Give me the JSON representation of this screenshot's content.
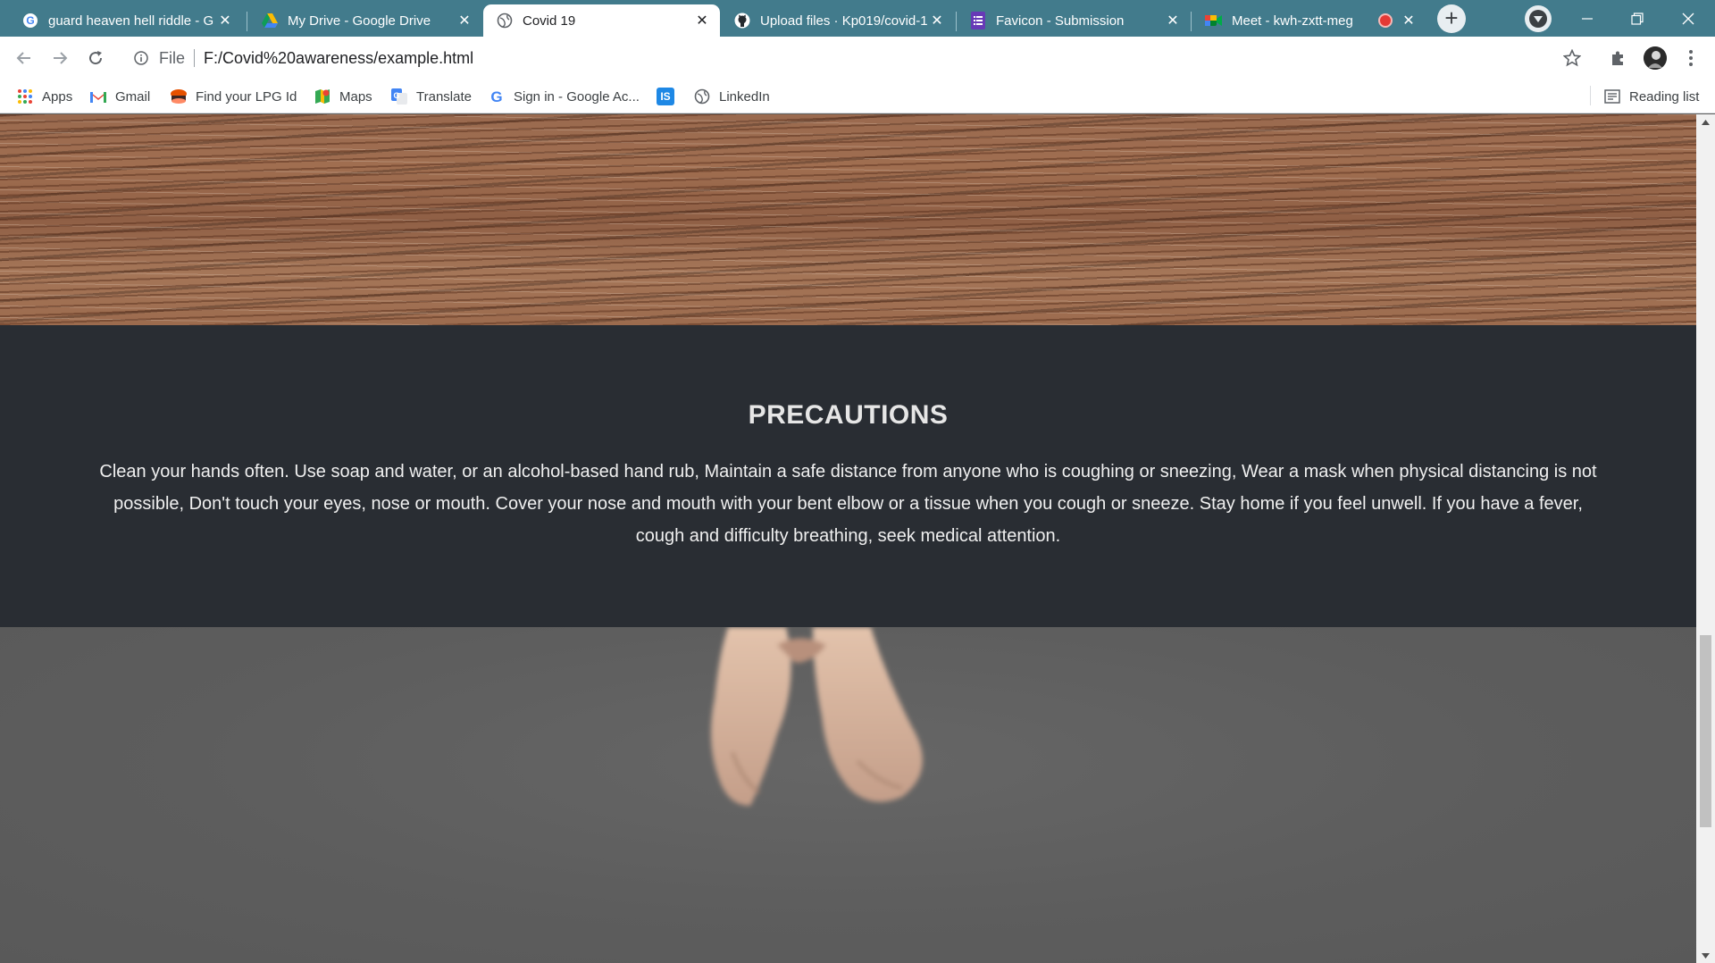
{
  "tabs": [
    {
      "title": "guard heaven hell riddle - G",
      "favicon": "google-icon"
    },
    {
      "title": "My Drive - Google Drive",
      "favicon": "google-drive-icon"
    },
    {
      "title": "Covid 19",
      "favicon": "globe-icon",
      "active": true
    },
    {
      "title": "Upload files · Kp019/covid-1",
      "favicon": "github-icon"
    },
    {
      "title": "Favicon - Submission",
      "favicon": "forms-icon"
    },
    {
      "title": "Meet - kwh-zxtt-meg",
      "favicon": "meet-icon",
      "recording": true
    }
  ],
  "omnibox": {
    "scheme": "File",
    "url": "F:/Covid%20awareness/example.html"
  },
  "bookmarks": [
    {
      "label": "Apps",
      "icon": "apps-grid-icon"
    },
    {
      "label": "Gmail",
      "icon": "gmail-icon"
    },
    {
      "label": "Find your LPG Id",
      "icon": "lpg-icon"
    },
    {
      "label": "Maps",
      "icon": "maps-icon"
    },
    {
      "label": "Translate",
      "icon": "translate-icon"
    },
    {
      "label": "Sign in - Google Ac...",
      "icon": "google-icon"
    },
    {
      "label": "",
      "icon": "is-badge-icon",
      "badge_text": "IS"
    },
    {
      "label": "LinkedIn",
      "icon": "globe-icon"
    }
  ],
  "reading_list": "Reading list",
  "page": {
    "precautions_title": "PRECAUTIONS",
    "precautions_text": "Clean your hands often. Use soap and water, or an alcohol-based hand rub, Maintain a safe distance from anyone who is coughing or sneezing, Wear a mask when physical distancing is not possible, Don't touch your eyes, nose or mouth. Cover your nose and mouth with your bent elbow or a tissue when you cough or sneeze. Stay home if you feel unwell. If you have a fever, cough and difficulty breathing, seek medical attention."
  },
  "colors": {
    "tabstrip": "#427b8c",
    "precautions_bg": "#292d33",
    "recording_dot": "#e53935"
  }
}
